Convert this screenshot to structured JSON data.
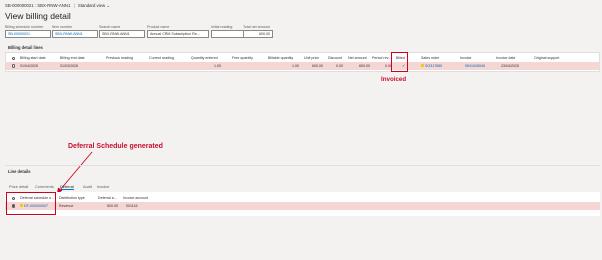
{
  "header": {
    "breadcrumb_title": "SB-000000021 : SBX-RNW-ANN1",
    "view_label": "Standard view",
    "page_title": "View billing detail",
    "fields": [
      {
        "label": "Billing schedule number",
        "value": "SB-00000021",
        "kind": "link"
      },
      {
        "label": "Item number",
        "value": "SBX-RNW-ANN1",
        "kind": "link"
      },
      {
        "label": "Search name",
        "value": "SBX-RNW-ANN1",
        "kind": "text"
      },
      {
        "label": "Product name",
        "value": "Annual CRM Subscription Re...",
        "kind": "text"
      },
      {
        "label": "Initial reading",
        "value": "",
        "kind": "text"
      },
      {
        "label": "Total net amount",
        "value": "600.00",
        "kind": "number"
      }
    ]
  },
  "billing_detail_lines": {
    "section_title": "Billing detail lines",
    "columns": [
      "Billing start date",
      "Billing end date",
      "Previous reading",
      "Current reading",
      "Quantity entered",
      "Free quantity",
      "Billable quantity",
      "Unit price",
      "Discount",
      "Net amount",
      "Period rev...",
      "Billed",
      "Sales order",
      "Invoice",
      "Invoice date",
      "Original support"
    ],
    "row": {
      "start": "01/04/2025",
      "end": "31/03/2026",
      "prev": "",
      "curr": "",
      "qty_entered": "1.00",
      "free": "",
      "billable": "1.00",
      "unit_price": "600.00",
      "discount": "0.00",
      "net": "600.00",
      "period": "0.00",
      "billed": "✓",
      "sales_order": "SO317650",
      "invoice": "SIN1028945",
      "invoice_date": "23/04/2025",
      "orig": ""
    }
  },
  "annotations": {
    "invoiced": "Invoiced",
    "deferral": "Deferral Schedule generated",
    "color": "#c8102e"
  },
  "line_details": {
    "section_title": "Line details",
    "tabs": [
      "Price detail",
      "Comments",
      "Deferral",
      "Audit",
      "Invoice"
    ],
    "active_tab": "Deferral",
    "columns": [
      "Deferral schedule n...",
      "Distribution type",
      "Deferral a...",
      "Invoice account"
    ],
    "row": {
      "schedule": "DF-000000007",
      "type": "Revenue",
      "amount": "600.00",
      "account": "001116"
    }
  }
}
